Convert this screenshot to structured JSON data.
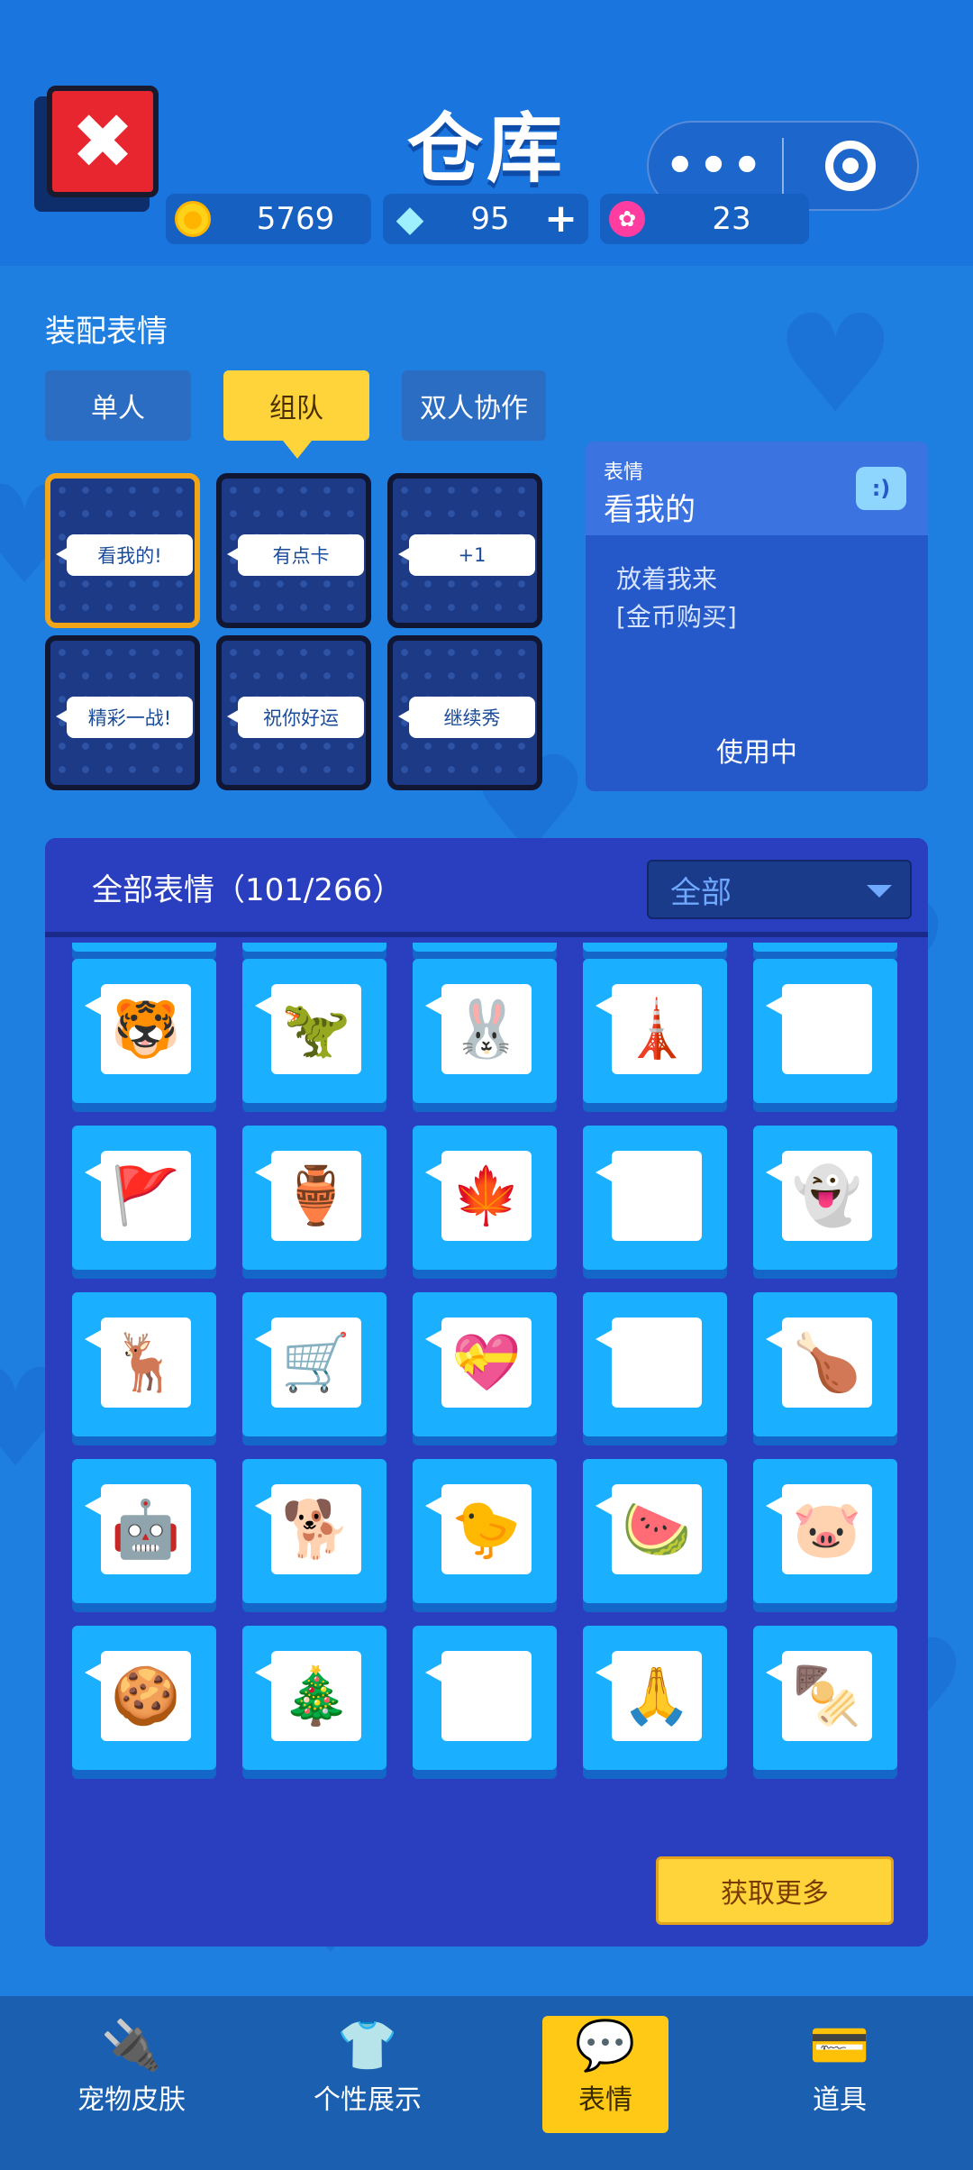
{
  "header": {
    "title": "仓库",
    "close_glyph": "✖",
    "capsule_more": "•••",
    "currencies": {
      "coins": "5769",
      "gems": "95",
      "gems_plus": "+",
      "flowers": "23"
    }
  },
  "equip": {
    "section_title": "装配表情",
    "tabs": [
      "单人",
      "组队",
      "双人协作"
    ],
    "active_tab": "组队",
    "slots": [
      "看我的!",
      "有点卡",
      "+1",
      "精彩一战!",
      "祝你好运",
      "继续秀"
    ],
    "selected_slot": "看我的!"
  },
  "detail": {
    "label": "表情",
    "name": "看我的",
    "icon": "chat-face-icon",
    "desc_line1": "放着我来",
    "desc_line2": "[金币购买]",
    "status": "使用中"
  },
  "all_emotes": {
    "title": "全部表情（101/266）",
    "filter_value": "全部",
    "more_button": "获取更多",
    "rows": [
      [
        {
          "icon": "tiger-face",
          "glyph": "🐯"
        },
        {
          "icon": "dinosaur",
          "glyph": "🦖"
        },
        {
          "icon": "rabbit",
          "glyph": "🐰"
        },
        {
          "icon": "tower-monument",
          "glyph": "🗼"
        },
        {
          "icon": "cloud-sun",
          "glyph": "🌤"
        }
      ],
      [
        {
          "icon": "red-flag",
          "glyph": "🚩"
        },
        {
          "icon": "wine-jar",
          "glyph": "🏺"
        },
        {
          "icon": "maple-leaf",
          "glyph": "🍁"
        },
        {
          "icon": "spider",
          "glyph": "🕷"
        },
        {
          "icon": "ghost",
          "glyph": "👻"
        }
      ],
      [
        {
          "icon": "reindeer",
          "glyph": "🦌"
        },
        {
          "icon": "shopping-cart",
          "glyph": "🛒"
        },
        {
          "icon": "rabbit-heart",
          "glyph": "💝"
        },
        {
          "icon": "monkey",
          "glyph": "🐵"
        },
        {
          "icon": "roast-chicken",
          "glyph": "🍗"
        }
      ],
      [
        {
          "icon": "robot",
          "glyph": "🤖"
        },
        {
          "icon": "shiba-dog",
          "glyph": "🐕"
        },
        {
          "icon": "chick-add-friend",
          "glyph": "🐤"
        },
        {
          "icon": "watermelon-rhino",
          "glyph": "🍉"
        },
        {
          "icon": "pig",
          "glyph": "🐷"
        }
      ],
      [
        {
          "icon": "gingerbread-man",
          "glyph": "🍪"
        },
        {
          "icon": "ornament-ball",
          "glyph": "🎄"
        },
        {
          "icon": "coffee-cup",
          "glyph": "☕"
        },
        {
          "icon": "praying-hands",
          "glyph": "🙏"
        },
        {
          "icon": "skewer",
          "glyph": "🍢"
        }
      ]
    ]
  },
  "nav": {
    "items": [
      {
        "label": "宠物皮肤",
        "icon": "plug-icon",
        "glyph": "🔌"
      },
      {
        "label": "个性展示",
        "icon": "shirt-icon",
        "glyph": "👕"
      },
      {
        "label": "表情",
        "icon": "chat-face-icon",
        "glyph": "💬"
      },
      {
        "label": "道具",
        "icon": "card-icon",
        "glyph": "💳"
      }
    ],
    "active": "表情"
  },
  "colors": {
    "bg": "#1f7fe0",
    "accent": "#ffd43a",
    "panel": "#2a3fbf",
    "cell": "#1ab0ff"
  }
}
